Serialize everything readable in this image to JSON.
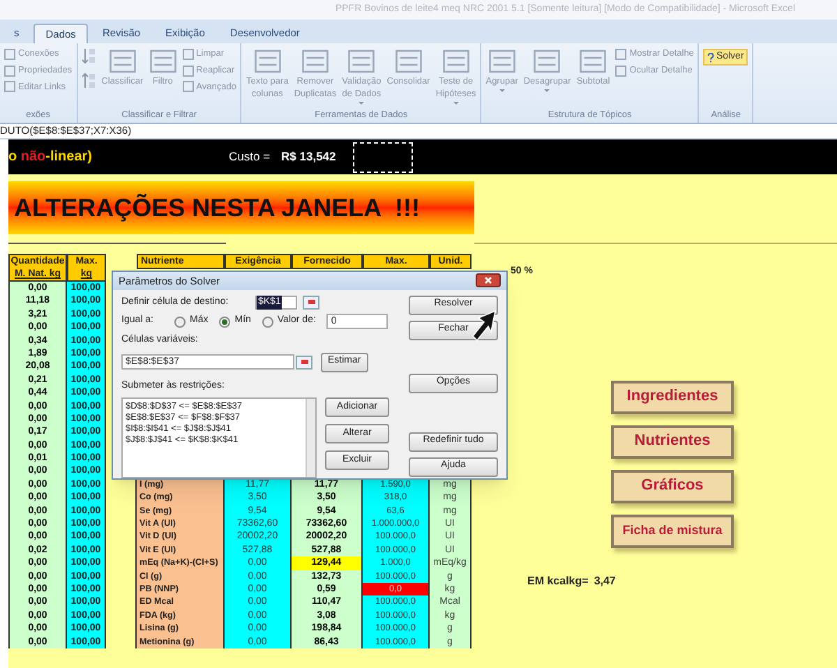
{
  "title_bar": {
    "title": "PPFR Bovinos de leite4 meq NRC 2001 5.1  [Somente leitura]  [Modo de Compatibilidade] - Microsoft Excel"
  },
  "ribbon_tabs": [
    {
      "label": "s",
      "selected": false
    },
    {
      "label": "Dados",
      "selected": true
    },
    {
      "label": "Revisão",
      "selected": false
    },
    {
      "label": "Exibição",
      "selected": false
    },
    {
      "label": "Desenvolvedor",
      "selected": false
    }
  ],
  "ribbon_groups": [
    {
      "label": "exões",
      "columns": [
        {
          "kind": "stack",
          "items": [
            "Conexões",
            "Propriedades",
            "Editar Links"
          ]
        }
      ]
    },
    {
      "label": "Classificar e Filtrar",
      "columns": [
        {
          "kind": "sort"
        },
        {
          "kind": "large",
          "lines": [
            "Classificar"
          ],
          "dropdown": false
        },
        {
          "kind": "large",
          "lines": [
            "Filtro"
          ],
          "dropdown": false
        },
        {
          "kind": "stack",
          "items": [
            "Limpar",
            "Reaplicar",
            "Avançado"
          ]
        }
      ]
    },
    {
      "label": "Ferramentas de Dados",
      "columns": [
        {
          "kind": "large",
          "lines": [
            "Texto para",
            "colunas"
          ],
          "dropdown": false
        },
        {
          "kind": "large",
          "lines": [
            "Remover",
            "Duplicatas"
          ],
          "dropdown": false
        },
        {
          "kind": "large",
          "lines": [
            "Validação",
            "de Dados"
          ],
          "dropdown": true
        },
        {
          "kind": "large",
          "lines": [
            "Consolidar"
          ],
          "dropdown": false
        },
        {
          "kind": "large",
          "lines": [
            "Teste de",
            "Hipóteses"
          ],
          "dropdown": true
        }
      ]
    },
    {
      "label": "Estrutura de Tópicos",
      "columns": [
        {
          "kind": "large",
          "lines": [
            "Agrupar"
          ],
          "dropdown": true
        },
        {
          "kind": "large",
          "lines": [
            "Desagrupar"
          ],
          "dropdown": true
        },
        {
          "kind": "large",
          "lines": [
            "Subtotal"
          ],
          "dropdown": false
        },
        {
          "kind": "stack",
          "items": [
            "Mostrar Detalhe",
            "Ocultar Detalhe"
          ]
        }
      ]
    },
    {
      "label": "Análise",
      "columns": [
        {
          "kind": "solver",
          "label": "Solver"
        }
      ]
    }
  ],
  "formula_bar": {
    "formula": "DUTO($E$8:$E$37;X7:X36)"
  },
  "header_bar": {
    "title_start": "o ",
    "title_red": "não",
    "title_end": "-linear)",
    "cost_label": "Custo =",
    "cost_value": "R$ 13,542"
  },
  "banner": "ALTERAÇÕES NESTA JANELA  !!!",
  "table": {
    "left_headers": [
      [
        "Quantidade",
        "M. Nat. kg"
      ],
      [
        "Max.",
        "kg"
      ]
    ],
    "right_headers": [
      "Nutriente",
      "Exigência",
      "Fornecido",
      "Max.",
      "Unid."
    ],
    "rows": [
      {
        "qty": "0,00",
        "max": "100,00"
      },
      {
        "qty": "11,18",
        "max": "100,00"
      },
      {
        "qty": "3,21",
        "max": "100,00"
      },
      {
        "qty": "0,00",
        "max": "100,00"
      },
      {
        "qty": "0,34",
        "max": "100,00"
      },
      {
        "qty": "1,89",
        "max": "100,00"
      },
      {
        "qty": "20,08",
        "max": "100,00"
      },
      {
        "qty": "0,21",
        "max": "100,00"
      },
      {
        "qty": "0,44",
        "max": "100,00"
      },
      {
        "qty": "0,00",
        "max": "100,00"
      },
      {
        "qty": "0,00",
        "max": "100,00"
      },
      {
        "qty": "0,17",
        "max": "100,00"
      },
      {
        "qty": "0,00",
        "max": "100,00"
      },
      {
        "qty": "0,01",
        "max": "100,00"
      },
      {
        "qty": "0,00",
        "max": "100,00"
      },
      {
        "qty": "0,00",
        "max": "100,00",
        "nutrient": {
          "name": "I (mg)",
          "req": "11,77",
          "given": "11,77",
          "max": "1.590,0",
          "unit": "mg",
          "given_flag": false,
          "max_flag": false
        }
      },
      {
        "qty": "0,00",
        "max": "100,00",
        "nutrient": {
          "name": "Co (mg)",
          "req": "3,50",
          "given": "3,50",
          "max": "318,0",
          "unit": "mg",
          "given_flag": false,
          "max_flag": false
        }
      },
      {
        "qty": "0,00",
        "max": "100,00",
        "nutrient": {
          "name": "Se (mg)",
          "req": "9,54",
          "given": "9,54",
          "max": "63,6",
          "unit": "mg",
          "given_flag": false,
          "max_flag": false
        }
      },
      {
        "qty": "0,00",
        "max": "100,00",
        "nutrient": {
          "name": "Vit A (UI)",
          "req": "73362,60",
          "given": "73362,60",
          "max": "1.000.000,0",
          "unit": "UI",
          "given_flag": false,
          "max_flag": false
        }
      },
      {
        "qty": "0,00",
        "max": "100,00",
        "nutrient": {
          "name": "Vit D  (UI)",
          "req": "20002,20",
          "given": "20002,20",
          "max": "100.000,0",
          "unit": "UI",
          "given_flag": false,
          "max_flag": false
        }
      },
      {
        "qty": "0,02",
        "max": "100,00",
        "nutrient": {
          "name": "Vit E  (UI)",
          "req": "527,88",
          "given": "527,88",
          "max": "100.000,0",
          "unit": "UI",
          "given_flag": false,
          "max_flag": false
        }
      },
      {
        "qty": "0,00",
        "max": "100,00",
        "nutrient": {
          "name": "mEq (Na+K)-(Cl+S)",
          "req": "0,00",
          "given": "129,44",
          "max": "1.000,0",
          "unit": "mEq/kg",
          "given_flag": true,
          "max_flag": false
        }
      },
      {
        "qty": "0,00",
        "max": "100,00",
        "nutrient": {
          "name": "Cl (g)",
          "req": "0,00",
          "given": "132,73",
          "max": "100.000,0",
          "unit": "g",
          "given_flag": false,
          "max_flag": false
        }
      },
      {
        "qty": "0,00",
        "max": "100,00",
        "nutrient": {
          "name": "PB (NNP)",
          "req": "0,00",
          "given": "0,59",
          "max": "0,0",
          "unit": "kg",
          "given_flag": false,
          "max_flag": true
        }
      },
      {
        "qty": "0,00",
        "max": "100,00",
        "nutrient": {
          "name": "ED Mcal",
          "req": "0,00",
          "given": "110,47",
          "max": "100.000,0",
          "unit": "Mcal",
          "given_flag": false,
          "max_flag": false
        }
      },
      {
        "qty": "0,00",
        "max": "100,00",
        "nutrient": {
          "name": "FDA (kg)",
          "req": "0,00",
          "given": "3,08",
          "max": "100.000,0",
          "unit": "kg",
          "given_flag": false,
          "max_flag": false
        }
      },
      {
        "qty": "0,00",
        "max": "100,00",
        "nutrient": {
          "name": "Lisina (g)",
          "req": "0,00",
          "given": "198,84",
          "max": "100.000,0",
          "unit": "g",
          "given_flag": false,
          "max_flag": false
        }
      },
      {
        "qty": "0,00",
        "max": "100,00",
        "nutrient": {
          "name": "Metionina (g)",
          "req": "0,00",
          "given": "86,43",
          "max": "100.000,0",
          "unit": "g",
          "given_flag": false,
          "max_flag": false
        }
      }
    ]
  },
  "side_note": "50 %",
  "nav_buttons": [
    "Ingredientes",
    "Nutrientes",
    "Gráficos",
    "Ficha de mistura"
  ],
  "em": {
    "label": "EM kcalkg=",
    "value": "3,47"
  },
  "solver_dialog": {
    "title": "Parâmetros do Solver",
    "target_label": "Definir célula de destino:",
    "target_value": "$K$1",
    "equal_label": "Igual a:",
    "options": [
      {
        "label": "Máx",
        "selected": false
      },
      {
        "label": "Mín",
        "selected": true
      },
      {
        "label": "Valor de:",
        "selected": false
      }
    ],
    "value_field": "0",
    "vars_label": "Células variáveis:",
    "vars_value": "$E$8:$E$37",
    "constraints_label": "Submeter às restrições:",
    "constraints": [
      "$D$8:$D$37 <= $E$8:$E$37",
      "$E$8:$E$37 <= $F$8:$F$37",
      "$I$8:$I$41 <= $J$8:$J$41",
      "$J$8:$J$41 <= $K$8:$K$41"
    ],
    "buttons": {
      "estimate": "Estimar",
      "add": "Adicionar",
      "change": "Alterar",
      "delete": "Excluir",
      "solve": "Resolver",
      "close": "Fechar",
      "options": "Opções",
      "reset": "Redefinir tudo",
      "help": "Ajuda"
    }
  }
}
